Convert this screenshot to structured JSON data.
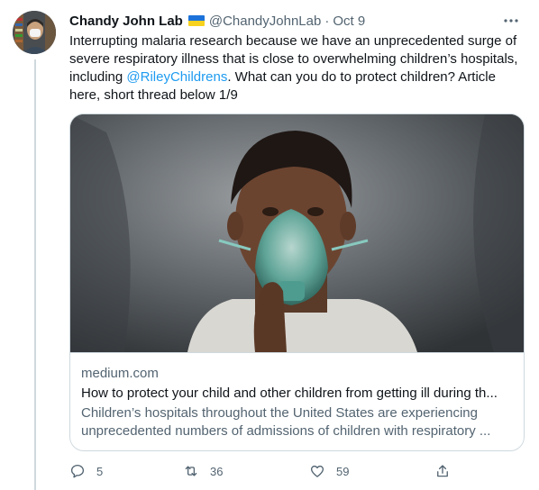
{
  "tweet": {
    "author_name": "Chandy John Lab",
    "handle": "@ChandyJohnLab",
    "separator": "·",
    "date": "Oct 9",
    "more_icon": "more-dots-icon",
    "text_before_mention": "Interrupting malaria research because we have an unprecedented surge of severe respiratory illness that is close to overwhelming children’s hospitals, including ",
    "mention": "@RileyChildrens",
    "text_after_mention": ". What can you do to protect children? Article here, short thread below 1/9"
  },
  "card": {
    "domain": "medium.com",
    "title": "How to protect your child and other children from getting ill during th...",
    "description": "Children’s hospitals throughout the United States are experiencing unprecedented numbers of admissions of children with respiratory ..."
  },
  "actions": {
    "reply_count": "5",
    "retweet_count": "36",
    "like_count": "59"
  },
  "colors": {
    "accent": "#1d9bf0",
    "secondary_text": "#536471",
    "border": "#cfd9de"
  }
}
